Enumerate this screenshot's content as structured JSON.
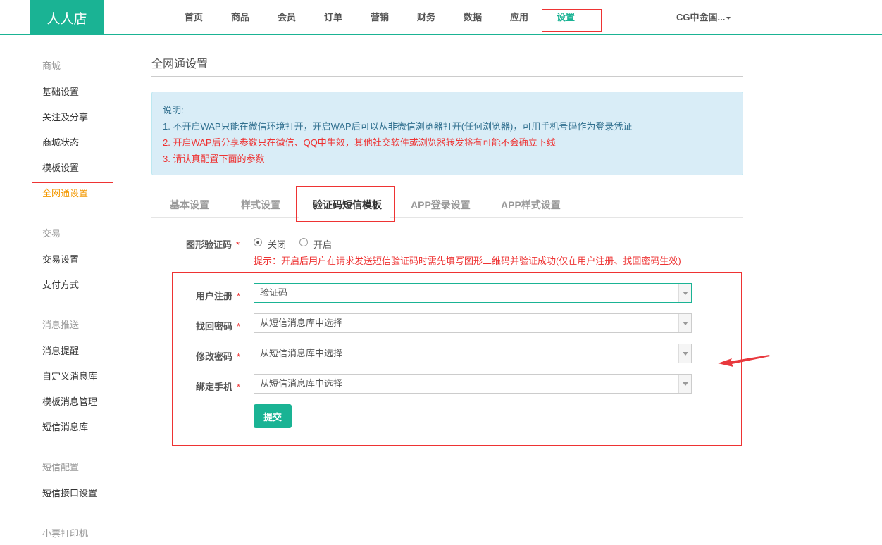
{
  "header": {
    "logo": "人人店",
    "nav": [
      "首页",
      "商品",
      "会员",
      "订单",
      "营销",
      "财务",
      "数据",
      "应用",
      "设置"
    ],
    "account": "CG中金国..."
  },
  "sidebar": {
    "groups": [
      {
        "title": "商城",
        "items": [
          "基础设置",
          "关注及分享",
          "商城状态",
          "模板设置",
          "全网通设置"
        ]
      },
      {
        "title": "交易",
        "items": [
          "交易设置",
          "支付方式"
        ]
      },
      {
        "title": "消息推送",
        "items": [
          "消息提醒",
          "自定义消息库",
          "模板消息管理",
          "短信消息库"
        ]
      },
      {
        "title": "短信配置",
        "items": [
          "短信接口设置"
        ]
      },
      {
        "title": "小票打印机",
        "items": []
      }
    ]
  },
  "main": {
    "title": "全网通设置",
    "notice": {
      "heading": "说明:",
      "line1": "1. 不开启WAP只能在微信环境打开，开启WAP后可以从非微信浏览器打开(任何浏览器)，可用手机号码作为登录凭证",
      "line2": "2. 开启WAP后分享参数只在微信、QQ中生效，其他社交软件或浏览器转发将有可能不会确立下线",
      "line3": "3. 请认真配置下面的参数"
    },
    "tabs": [
      "基本设置",
      "样式设置",
      "验证码短信模板",
      "APP登录设置",
      "APP样式设置"
    ],
    "captcha": {
      "label": "图形验证码",
      "required": "*",
      "option_off": "关闭",
      "option_on": "开启",
      "hint": "提示：开启后用户在请求发送短信验证码时需先填写图形二维码并验证成功(仅在用户注册、找回密码生效)"
    },
    "fields": [
      {
        "label": "用户注册",
        "value": "验证码"
      },
      {
        "label": "找回密码",
        "value": "从短信消息库中选择"
      },
      {
        "label": "修改密码",
        "value": "从短信消息库中选择"
      },
      {
        "label": "绑定手机",
        "value": "从短信消息库中选择"
      }
    ],
    "submit": "提交"
  },
  "colors": {
    "brand": "#1ab394",
    "warning": "#e33",
    "active_sidebar": "#f39800"
  }
}
